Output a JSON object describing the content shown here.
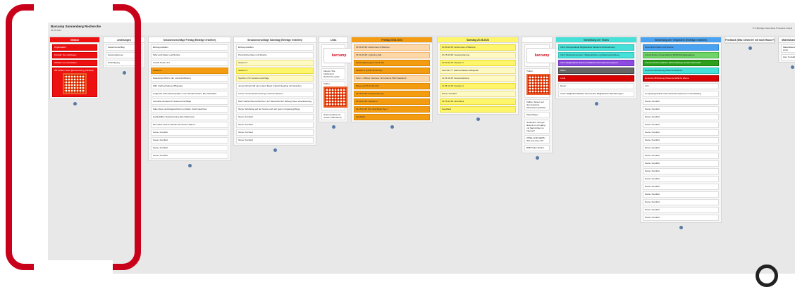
{
  "board": {
    "title": "Barcamp Sonnenberg Recherche",
    "subtitle": "28.08.2023",
    "header_right": "% 0 Beitrage habe diese Pinnwand erstellt"
  },
  "columns": [
    {
      "head": "Infobox",
      "color": "red",
      "cards": [
        {
          "text": "Organisation",
          "cls": "red"
        },
        {
          "text": "Kontakt: hier nachlesen",
          "cls": "red"
        },
        {
          "text": "Schilder zum Herstellen",
          "cls": "red"
        },
        {
          "text": "Wir twittern unter @sonnenberg_barcamp",
          "cls": "red"
        }
      ]
    },
    {
      "head": "Anleitungen",
      "cards": [
        {
          "text": "Sessionvorschlag"
        },
        {
          "text": "Sessionplanung"
        },
        {
          "text": "Nachfolgung"
        }
      ]
    },
    {
      "head": "Sessionvorschläge Freitag (Einträge erstellen)",
      "cards": [
        {
          "text": "Eintrag erstellen"
        },
        {
          "text": "Tafel sieht Daten und Rechte"
        },
        {
          "text": "Anzahl Nutzer 3.0"
        },
        {
          "text": "Session 1",
          "cls": "orange"
        },
        {
          "text": "Datenlinks DOM in der Lehrerfortbildung"
        },
        {
          "text": "Wiki: Sachverhaltene Wikipedia"
        },
        {
          "text": "Ungleiche Informationsquellen in der Schule fördern: Ein Arbeitsfeld"
        },
        {
          "text": "Sexueller Hinweis für Sessionvorschläge"
        },
        {
          "text": "Fake News und Zeitgeschehen ermitteln, Suchmaschinen"
        },
        {
          "text": "Handelsfilter Verantwortung Eine Diskussion"
        },
        {
          "text": "Ein Fettes Thema: Woran will meinen Daten?"
        },
        {
          "text": "Name: Kursfeld"
        },
        {
          "text": "Name: Kursfeld"
        },
        {
          "text": "Name: Kursfeld"
        },
        {
          "text": "Name: Kursfeld"
        }
      ]
    },
    {
      "head": "Sessionvorschläge Samstag (Einträge erstellen)",
      "cards": [
        {
          "text": "Eintrag erstellen"
        },
        {
          "text": "Persönliche Daten und Rechte"
        },
        {
          "text": "Session 3",
          "cls": "lyellow"
        },
        {
          "text": "Session 4",
          "cls": "yellow"
        },
        {
          "text": "Speichern für Sessionvorschläge",
          "cls": "lyellow"
        },
        {
          "text": "Jonas Schnell: Mit einer Hand Read / Notiert Reading mit Sprachen"
        },
        {
          "text": "Lehrer: Provenienzforschung in kleinen Museen"
        },
        {
          "text": "Mehr Nachrichtenrecherchen, der Tauschzeit der Stiftung Neue Verantwortung"
        },
        {
          "text": "Name: Workshop auf der Suche nach der guten Umgebung/Dinge"
        },
        {
          "text": "Name: Kursfeld"
        },
        {
          "text": "Name: Kursfeld"
        },
        {
          "text": "Name: Kursfeld"
        },
        {
          "text": "Name: Kursfeld"
        }
      ]
    },
    {
      "head": "Links",
      "cards": [
        {
          "text": "barcamp logo"
        },
        {
          "text": "Mausio: Wie funktioniert Recherche gratis"
        },
        {
          "text": "Twitter"
        },
        {
          "text": "Dokumentation (in neuem TAB öffnen)"
        }
      ]
    },
    {
      "head": "Freitag 25.08.2023",
      "color": "orange",
      "cards": [
        {
          "text": "15:00-15:30: Ankommen & Warmup",
          "cls": "lorange"
        },
        {
          "text": "15:30-15:45: Lightning-Talk",
          "cls": "lorange"
        },
        {
          "text": "Sessionplanung (11:10-11:30)",
          "cls": "orange"
        },
        {
          "text": "Session 1 (11:30-12:15 Uhr)",
          "cls": "orange"
        },
        {
          "text": "Slow 1: Affiliary Interview mit Johanna Willi (Saarland)",
          "cls": "lorange"
        },
        {
          "text": "Pause (12:15-13:15 Uhr)",
          "cls": "orange"
        },
        {
          "text": "13:15-13:30: Sessionplanung",
          "cls": "orange"
        },
        {
          "text": "13:30-14:15: Session 2",
          "cls": "orange"
        },
        {
          "text": "14:15-14:45 Uhr: Abschluss Tag 1",
          "cls": "orange"
        },
        {
          "text": "Feedback",
          "cls": "orange"
        }
      ]
    },
    {
      "head": "Samstag 26.08.2023",
      "color": "yellow",
      "cards": [
        {
          "text": "10:00-10:15: Ankommen & Warmup",
          "cls": "yellow"
        },
        {
          "text": "10:15-10:30: Sessionplanung",
          "cls": "lyellow"
        },
        {
          "text": "10:30-11:15: Session 3",
          "cls": "yellow"
        },
        {
          "text": "Seminar ??: Sachverhaltene Wikipedia",
          "cls": "lyellow"
        },
        {
          "text": "11:15-11:45: Sessionplanung",
          "cls": "lyellow"
        },
        {
          "text": "11:45-12:15: Session 4",
          "cls": "yellow"
        },
        {
          "text": "Name: Kursfeld",
          "cls": "lyellow"
        },
        {
          "text": "12:15-12:45: Abschluss",
          "cls": "yellow"
        },
        {
          "text": "Feedback",
          "cls": "yellow"
        }
      ]
    },
    {
      "head": "",
      "cards": [
        {
          "text": "barcamp logo"
        },
        {
          "text": "Twitter"
        },
        {
          "text": "Kaffee / Essen auf dem barcamp (Orientierung 00:00)"
        },
        {
          "text": "Papierflieger"
        },
        {
          "text": "Neuheiten: Wie gut lässt du im Umgang mit Nachrichten im Internet?"
        },
        {
          "text": "ZITIEL AND NEWS: Wie lese lese ich?"
        },
        {
          "text": "BMP Feller Mindar"
        }
      ]
    },
    {
      "head": "Vorstellung der Teams",
      "color": "cyan",
      "cards": [
        {
          "text": "Clinic Feinsgebäude Mitgliedsliste Medienschnellandreiten",
          "cls": "cyan"
        },
        {
          "text": "Clinic Medienkompetenz: Mitgliederliste ung Weiterentwicklung",
          "cls": "cyan"
        },
        {
          "text": "Clinic Mitgliedsliste Wissenschaftliche Informationskompetenz",
          "cls": "violet"
        },
        {
          "text": "Hilfen",
          "cls": "gray"
        },
        {
          "text": "Lokal",
          "cls": "dred"
        },
        {
          "text": "Dauer"
        },
        {
          "text": "Arnon Mitgliedschaftsliste Assessment Mitgliedsliste Betrachtungen"
        }
      ]
    },
    {
      "head": "Vorstellung der Teilgebiete (Einträge erstellen)",
      "color": "blue",
      "cards": [
        {
          "text": "Persönliche Daten und Rechte",
          "cls": "blue"
        },
        {
          "text": "Annual Nutzen Veranstaltung WOW Erfolgsangebote",
          "cls": "green"
        },
        {
          "text": "Annual Wochenzeitlicher Wirtschaftsfolg, Reader Wirtschaft",
          "cls": "dgreen"
        },
        {
          "text": "Deutsche Bildzeitung Wissenschaftliche",
          "cls": "cyan"
        },
        {
          "text": "Deutsche Bildzeitung Wissenschaftliche Ebene",
          "cls": "dred"
        },
        {
          "text": "Link"
        },
        {
          "text": "Computergestützte Informationskompetenzen Lehrerbildung"
        },
        {
          "text": "Name: Kursfeld"
        },
        {
          "text": "Name: Kursfeld"
        },
        {
          "text": "Name: Kursfeld"
        },
        {
          "text": "Name: Kursfeld"
        },
        {
          "text": "Name: Kursfeld"
        },
        {
          "text": "Name: Kursfeld"
        },
        {
          "text": "Name: Kursfeld"
        },
        {
          "text": "Name: Kursfeld"
        },
        {
          "text": "Name: Kursfeld"
        },
        {
          "text": "Name: Kursfeld"
        },
        {
          "text": "Name: Kursfeld"
        },
        {
          "text": "Name: Kursfeld"
        },
        {
          "text": "Name: Kursfeld"
        },
        {
          "text": "Name: Kursfeld"
        },
        {
          "text": "Name: Kursfeld"
        },
        {
          "text": "Name: Kursfeld"
        }
      ]
    },
    {
      "head": "Feedback (Was nehmt ihr mit nach Hause?)",
      "cards": []
    },
    {
      "head": "Materialsammlung",
      "cards": [
        {
          "text": "Materialsammlung: Links"
        },
        {
          "text": "Hier: Kontakt"
        }
      ]
    }
  ],
  "colors": {
    "accent_red": "#c8001a",
    "board_bg": "#e8e8e8"
  }
}
